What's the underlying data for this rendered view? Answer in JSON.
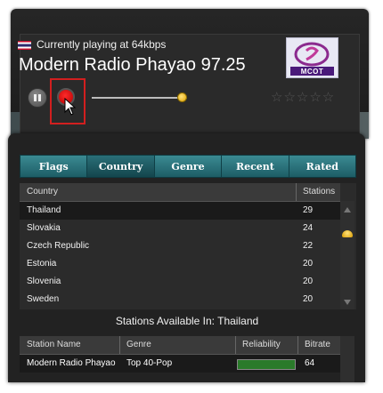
{
  "player": {
    "now_playing_text": "Currently playing at 64kbps",
    "station_name": "Modern Radio Phayao 97.25",
    "flag_icon": "thailand-flag-icon",
    "logo_text": "MCOT",
    "volume_fraction": 0.95,
    "rating_stars": "☆☆☆☆☆",
    "rating_value": 0
  },
  "tabs": [
    {
      "label": "Flags"
    },
    {
      "label": "Country"
    },
    {
      "label": "Genre"
    },
    {
      "label": "Recent"
    },
    {
      "label": "Rated"
    }
  ],
  "country_table": {
    "headers": {
      "country": "Country",
      "stations": "Stations"
    },
    "rows": [
      {
        "country": "Thailand",
        "stations": "29"
      },
      {
        "country": "Slovakia",
        "stations": "24"
      },
      {
        "country": "Czech Republic",
        "stations": "22"
      },
      {
        "country": "Estonia",
        "stations": "20"
      },
      {
        "country": "Slovenia",
        "stations": "20"
      },
      {
        "country": "Sweden",
        "stations": "20"
      }
    ]
  },
  "stations_section": {
    "title": "Stations Available In: Thailand",
    "headers": {
      "name": "Station Name",
      "genre": "Genre",
      "reliability": "Reliability",
      "bitrate": "Bitrate"
    },
    "rows": [
      {
        "name": "Modern Radio Phayao",
        "genre": "Top 40-Pop",
        "reliability": 1.0,
        "bitrate": "64"
      }
    ]
  },
  "colors": {
    "record": "#e00000",
    "tab_bg": "#2a7a84",
    "highlight_box": "#d21f1f",
    "volume_knob": "#f0b800"
  }
}
